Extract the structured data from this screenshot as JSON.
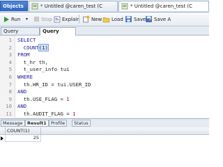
{
  "tabs": {
    "objects": "Objects",
    "query1": "* Untitled @caren_test (C",
    "query2": "* Untitled @caren_test (C"
  },
  "toolbar": {
    "run": "Run",
    "stop": "Stop",
    "explain": "Explain",
    "new": "New",
    "load": "Load",
    "save": "Save",
    "save_as": "Save A"
  },
  "subtabs": [
    "Query Builder",
    "Query Editor"
  ],
  "editor": {
    "lines": [
      {
        "n": "1",
        "segments": [
          {
            "t": "SELECT",
            "c": "kw"
          }
        ]
      },
      {
        "n": "2",
        "segments": [
          {
            "t": "  COUNT",
            "c": "kw"
          },
          {
            "t": "(1)",
            "c": "hl"
          }
        ]
      },
      {
        "n": "3",
        "segments": [
          {
            "t": "FROM",
            "c": "kw"
          }
        ]
      },
      {
        "n": "4",
        "segments": [
          {
            "t": "  t_hr th,",
            "c": ""
          }
        ]
      },
      {
        "n": "5",
        "segments": [
          {
            "t": "  t_user_info tui",
            "c": ""
          }
        ]
      },
      {
        "n": "6",
        "segments": [
          {
            "t": "WHERE",
            "c": "kw"
          }
        ]
      },
      {
        "n": "7",
        "segments": [
          {
            "t": "  th.HR_ID = tui.USER_ID",
            "c": ""
          }
        ]
      },
      {
        "n": "8",
        "segments": [
          {
            "t": "AND",
            "c": "kw"
          }
        ]
      },
      {
        "n": "9",
        "segments": [
          {
            "t": "  th.USE_FLAG = ",
            "c": ""
          },
          {
            "t": "1",
            "c": "num"
          }
        ]
      },
      {
        "n": "10",
        "segments": [
          {
            "t": "AND",
            "c": "kw"
          }
        ]
      },
      {
        "n": "11",
        "segments": [
          {
            "t": "  th.AUDIT_FLAG = ",
            "c": ""
          },
          {
            "t": "1",
            "c": "num"
          }
        ]
      }
    ]
  },
  "result_tabs": [
    "Message",
    "Result1",
    "Profile",
    "Status"
  ],
  "grid": {
    "column": "COUNT(1)",
    "value": "25"
  }
}
